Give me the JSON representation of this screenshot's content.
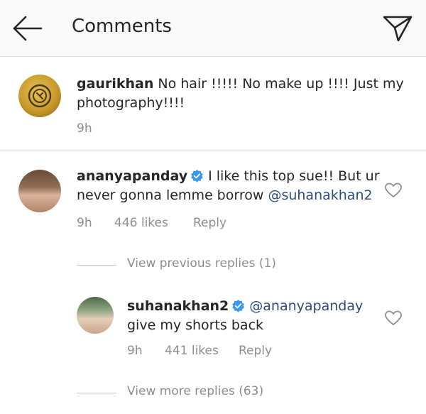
{
  "header": {
    "title": "Comments",
    "back_icon": "arrow-left-icon",
    "share_icon": "send-icon"
  },
  "owner_comment": {
    "username": "gaurikhan",
    "text_line1": "No hair !!!!! No make up !!!! Just my",
    "text_line2": "photography!!!!",
    "time": "9h"
  },
  "comments": [
    {
      "username": "ananyapanday",
      "verified": true,
      "text_line1": "I like this top sue!! But ur",
      "text_line2_prefix": "never gonna lemme borrow",
      "mention": "@suhanakhan2",
      "time": "9h",
      "likes": "446 likes",
      "reply_label": "Reply"
    }
  ],
  "replies": [
    {
      "username": "suhanakhan2",
      "verified": true,
      "mention": "@ananyapanday",
      "text_line2": "give my shorts back",
      "time": "9h",
      "likes": "441 likes",
      "reply_label": "Reply"
    }
  ],
  "view_previous_replies": "View previous replies (1)",
  "view_more_replies": "View more replies (63)",
  "colors": {
    "text": "#262626",
    "secondary": "#8e8e8e",
    "mention": "#2a4d7a",
    "verified": "#3897f0",
    "header_bg": "#f9f9f9",
    "divider": "#dbdbdb"
  }
}
